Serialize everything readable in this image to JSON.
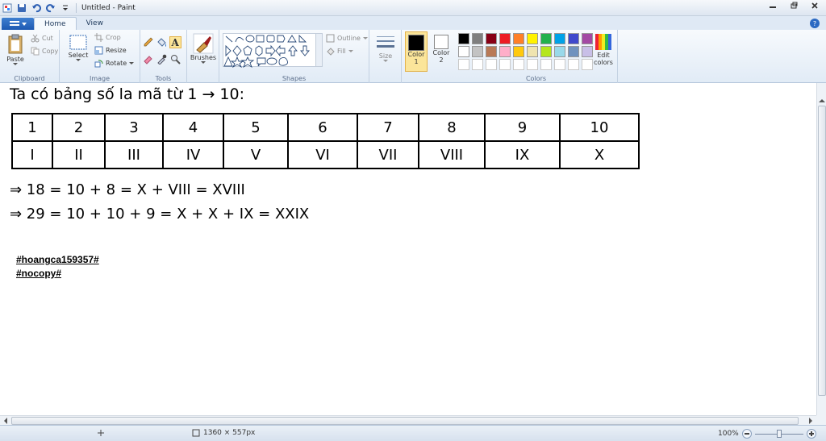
{
  "window": {
    "title": "Untitled - Paint"
  },
  "tabs": [
    {
      "label": "Home"
    },
    {
      "label": "View"
    }
  ],
  "ribbon": {
    "clipboard": {
      "label": "Clipboard",
      "paste": "Paste",
      "cut": "Cut",
      "copy": "Copy"
    },
    "image": {
      "label": "Image",
      "select": "Select",
      "crop": "Crop",
      "resize": "Resize",
      "rotate": "Rotate"
    },
    "tools": {
      "label": "Tools"
    },
    "brushes": {
      "label": "Brushes"
    },
    "shapes": {
      "label": "Shapes",
      "outline": "Outline",
      "fill": "Fill"
    },
    "size": {
      "label": "Size"
    },
    "color1": {
      "label": "Color",
      "index": "1"
    },
    "color2": {
      "label": "Color",
      "index": "2"
    },
    "colors": {
      "label": "Colors",
      "row1": [
        "#000000",
        "#7f7f7f",
        "#880015",
        "#ed1c24",
        "#ff7f27",
        "#fff200",
        "#22b14c",
        "#00a2e8",
        "#3f48cc",
        "#a349a4"
      ],
      "row2": [
        "#ffffff",
        "#c3c3c3",
        "#b97a57",
        "#ffaec9",
        "#ffc90e",
        "#efe4b0",
        "#b5e61d",
        "#99d9ea",
        "#7092be",
        "#c8bfe7"
      ],
      "edit_label": "Edit colors"
    }
  },
  "canvas": {
    "heading": "Ta có bảng số la mã từ 1 → 10:",
    "table": {
      "numbers": [
        "1",
        "2",
        "3",
        "4",
        "5",
        "6",
        "7",
        "8",
        "9",
        "10"
      ],
      "roman": [
        "I",
        "II",
        "III",
        "IV",
        "V",
        "VI",
        "VII",
        "VIII",
        "IX",
        "X"
      ]
    },
    "line1": "⇒ 18 = 10 + 8 = X + VIII = XVIII",
    "line2": "⇒ 29 = 10 + 10 + 9 = X + X + IX = XXIX",
    "tag1": "#hoangca159357#",
    "tag2": "#nocopy#"
  },
  "status": {
    "size": "1360 × 557px",
    "zoom": "100%"
  }
}
